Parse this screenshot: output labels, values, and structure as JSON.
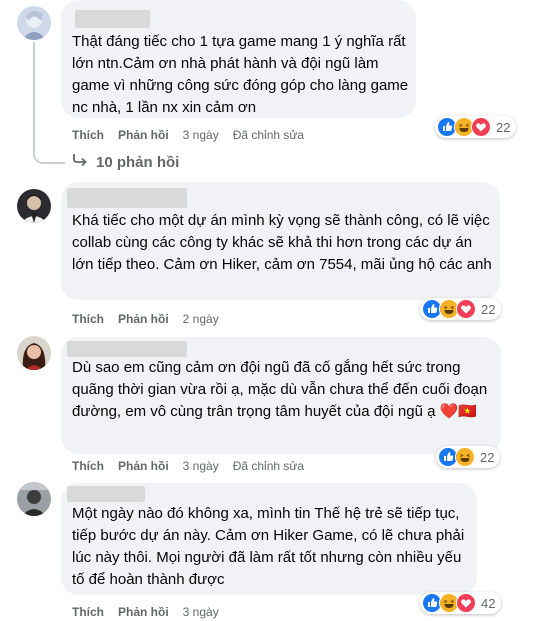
{
  "comments": [
    {
      "text": "Thật đáng tiếc cho 1 tựa game mang 1 ý nghĩa rất lớn ntn.Cảm ơn nhà phát hành và đội ngũ làm game vì những công sức đóng góp cho làng game nc nhà, 1 lần nx xin cảm ơn",
      "like_label": "Thích",
      "reply_label": "Phản hồi",
      "time": "3 ngày",
      "edited": "Đã chỉnh sửa",
      "reactions": [
        "like",
        "haha",
        "heart"
      ],
      "reaction_count": "22"
    },
    {
      "text": "Khá tiếc cho một dự án mình kỳ vọng sẽ thành công, có lẽ việc collab cùng các công ty khác sẽ khả thi hơn trong các dự án lớn tiếp theo. Cảm ơn Hiker, cảm ơn 7554, mãi ủng hộ các anh",
      "like_label": "Thích",
      "reply_label": "Phản hồi",
      "time": "2 ngày",
      "reactions": [
        "like",
        "haha",
        "heart"
      ],
      "reaction_count": "22"
    },
    {
      "text": "Dù sao em cũng cảm ơn đội ngũ đã cố gắng hết sức trong quãng thời gian vừa rồi ạ, mặc dù vẫn chưa thể đến cuối đoạn đường, em vô cùng trân trọng tâm huyết của đội ngũ ạ ❤️🇻🇳",
      "like_label": "Thích",
      "reply_label": "Phản hồi",
      "time": "3 ngày",
      "edited": "Đã chỉnh sửa",
      "reactions": [
        "like",
        "haha"
      ],
      "reaction_count": "22"
    },
    {
      "text": "Một ngày nào đó không xa, mình tin Thế hệ trẻ sẽ tiếp tục, tiếp bước dự án này. Cảm ơn Hiker Game, có lẽ chưa phải lúc này thôi. Mọi người đã làm rất tốt nhưng còn nhiều yếu tố để hoàn thành được",
      "like_label": "Thích",
      "reply_label": "Phản hồi",
      "time": "3 ngày",
      "reactions": [
        "like",
        "haha",
        "heart"
      ],
      "reaction_count": "42"
    }
  ],
  "replies_link": "10 phản hồi",
  "colors": {
    "like": "#1877f2",
    "haha": "#f7b125",
    "heart": "#f33e58",
    "bubble": "#f0f2f5",
    "muted": "#65676b"
  }
}
